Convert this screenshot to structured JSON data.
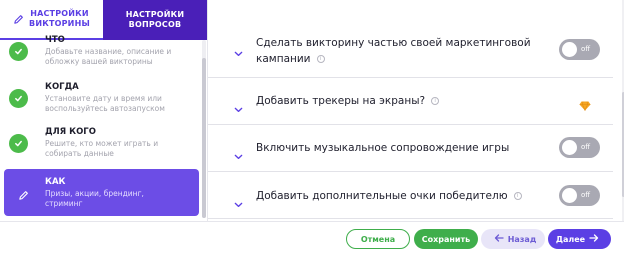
{
  "tabs": [
    {
      "label": "НАСТРОЙКИ ВИКТОРИНЫ",
      "active": true
    },
    {
      "label": "НАСТРОЙКИ ВОПРОСОВ",
      "active": false
    }
  ],
  "nav": [
    {
      "title": "ЧТО",
      "desc": "Добавьте название, описание и обложку вашей викторины",
      "status": "done"
    },
    {
      "title": "КОГДА",
      "desc": "Установите дату и время или воспользуйтесь автозапуском",
      "status": "done"
    },
    {
      "title": "ДЛЯ КОГО",
      "desc": "Решите, кто может играть и собирать данные",
      "status": "done"
    },
    {
      "title": "КАК",
      "desc": "Призы, акции, брендинг, стриминг",
      "status": "active"
    }
  ],
  "settings": [
    {
      "label": "Сделать викторину частью своей маркетинговой кампании",
      "control": "toggle",
      "value": "off"
    },
    {
      "label": "Добавить трекеры на экраны?",
      "control": "premium-gem",
      "value": ""
    },
    {
      "label": "Включить музыкальное сопровождение игры",
      "control": "toggle",
      "value": "off"
    },
    {
      "label": "Добавить дополнительные очки победителю",
      "control": "toggle",
      "value": "off"
    }
  ],
  "footer": {
    "cancel": "Отмена",
    "save": "Сохранить",
    "back": "Назад",
    "next": "Далее"
  },
  "colors": {
    "accent": "#5b3fe4",
    "dark_tab": "#4a1fb8",
    "success": "#3fae4b",
    "toggle_off": "#a9a9b3"
  }
}
